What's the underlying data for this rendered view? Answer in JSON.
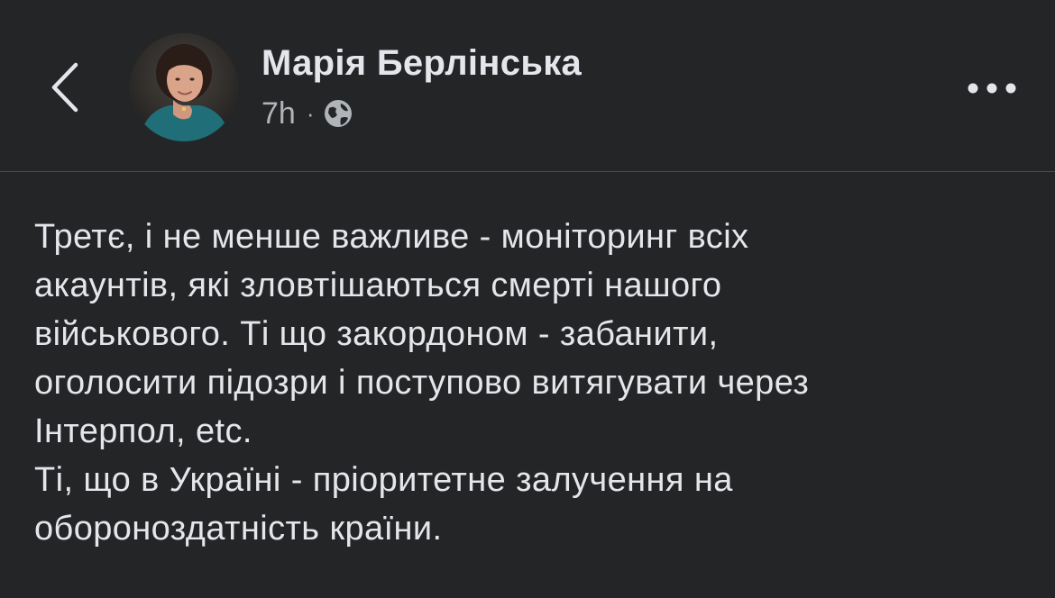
{
  "header": {
    "back_icon": "chevron-left-icon",
    "author_name": "Марія Берлінська",
    "time": "7h",
    "separator": "·",
    "audience_icon": "globe-icon",
    "more_icon": "more-horizontal-icon"
  },
  "post": {
    "lines": [
      "Третє, і не менше важливе - моніторинг всіх",
      "акаунтів, які зловтішаються смерті нашого",
      "військового. Ті що закордоном - забанити,",
      "оголосити підозри і поступово витягувати через",
      "Інтерпол, etc.",
      "Ті, що в Україні - пріоритетне залучення на",
      "обороноздатність країни."
    ]
  },
  "colors": {
    "background": "#242526",
    "text_primary": "#e4e6eb",
    "text_secondary": "#b0b3b8",
    "divider": "#4a4b4d"
  }
}
